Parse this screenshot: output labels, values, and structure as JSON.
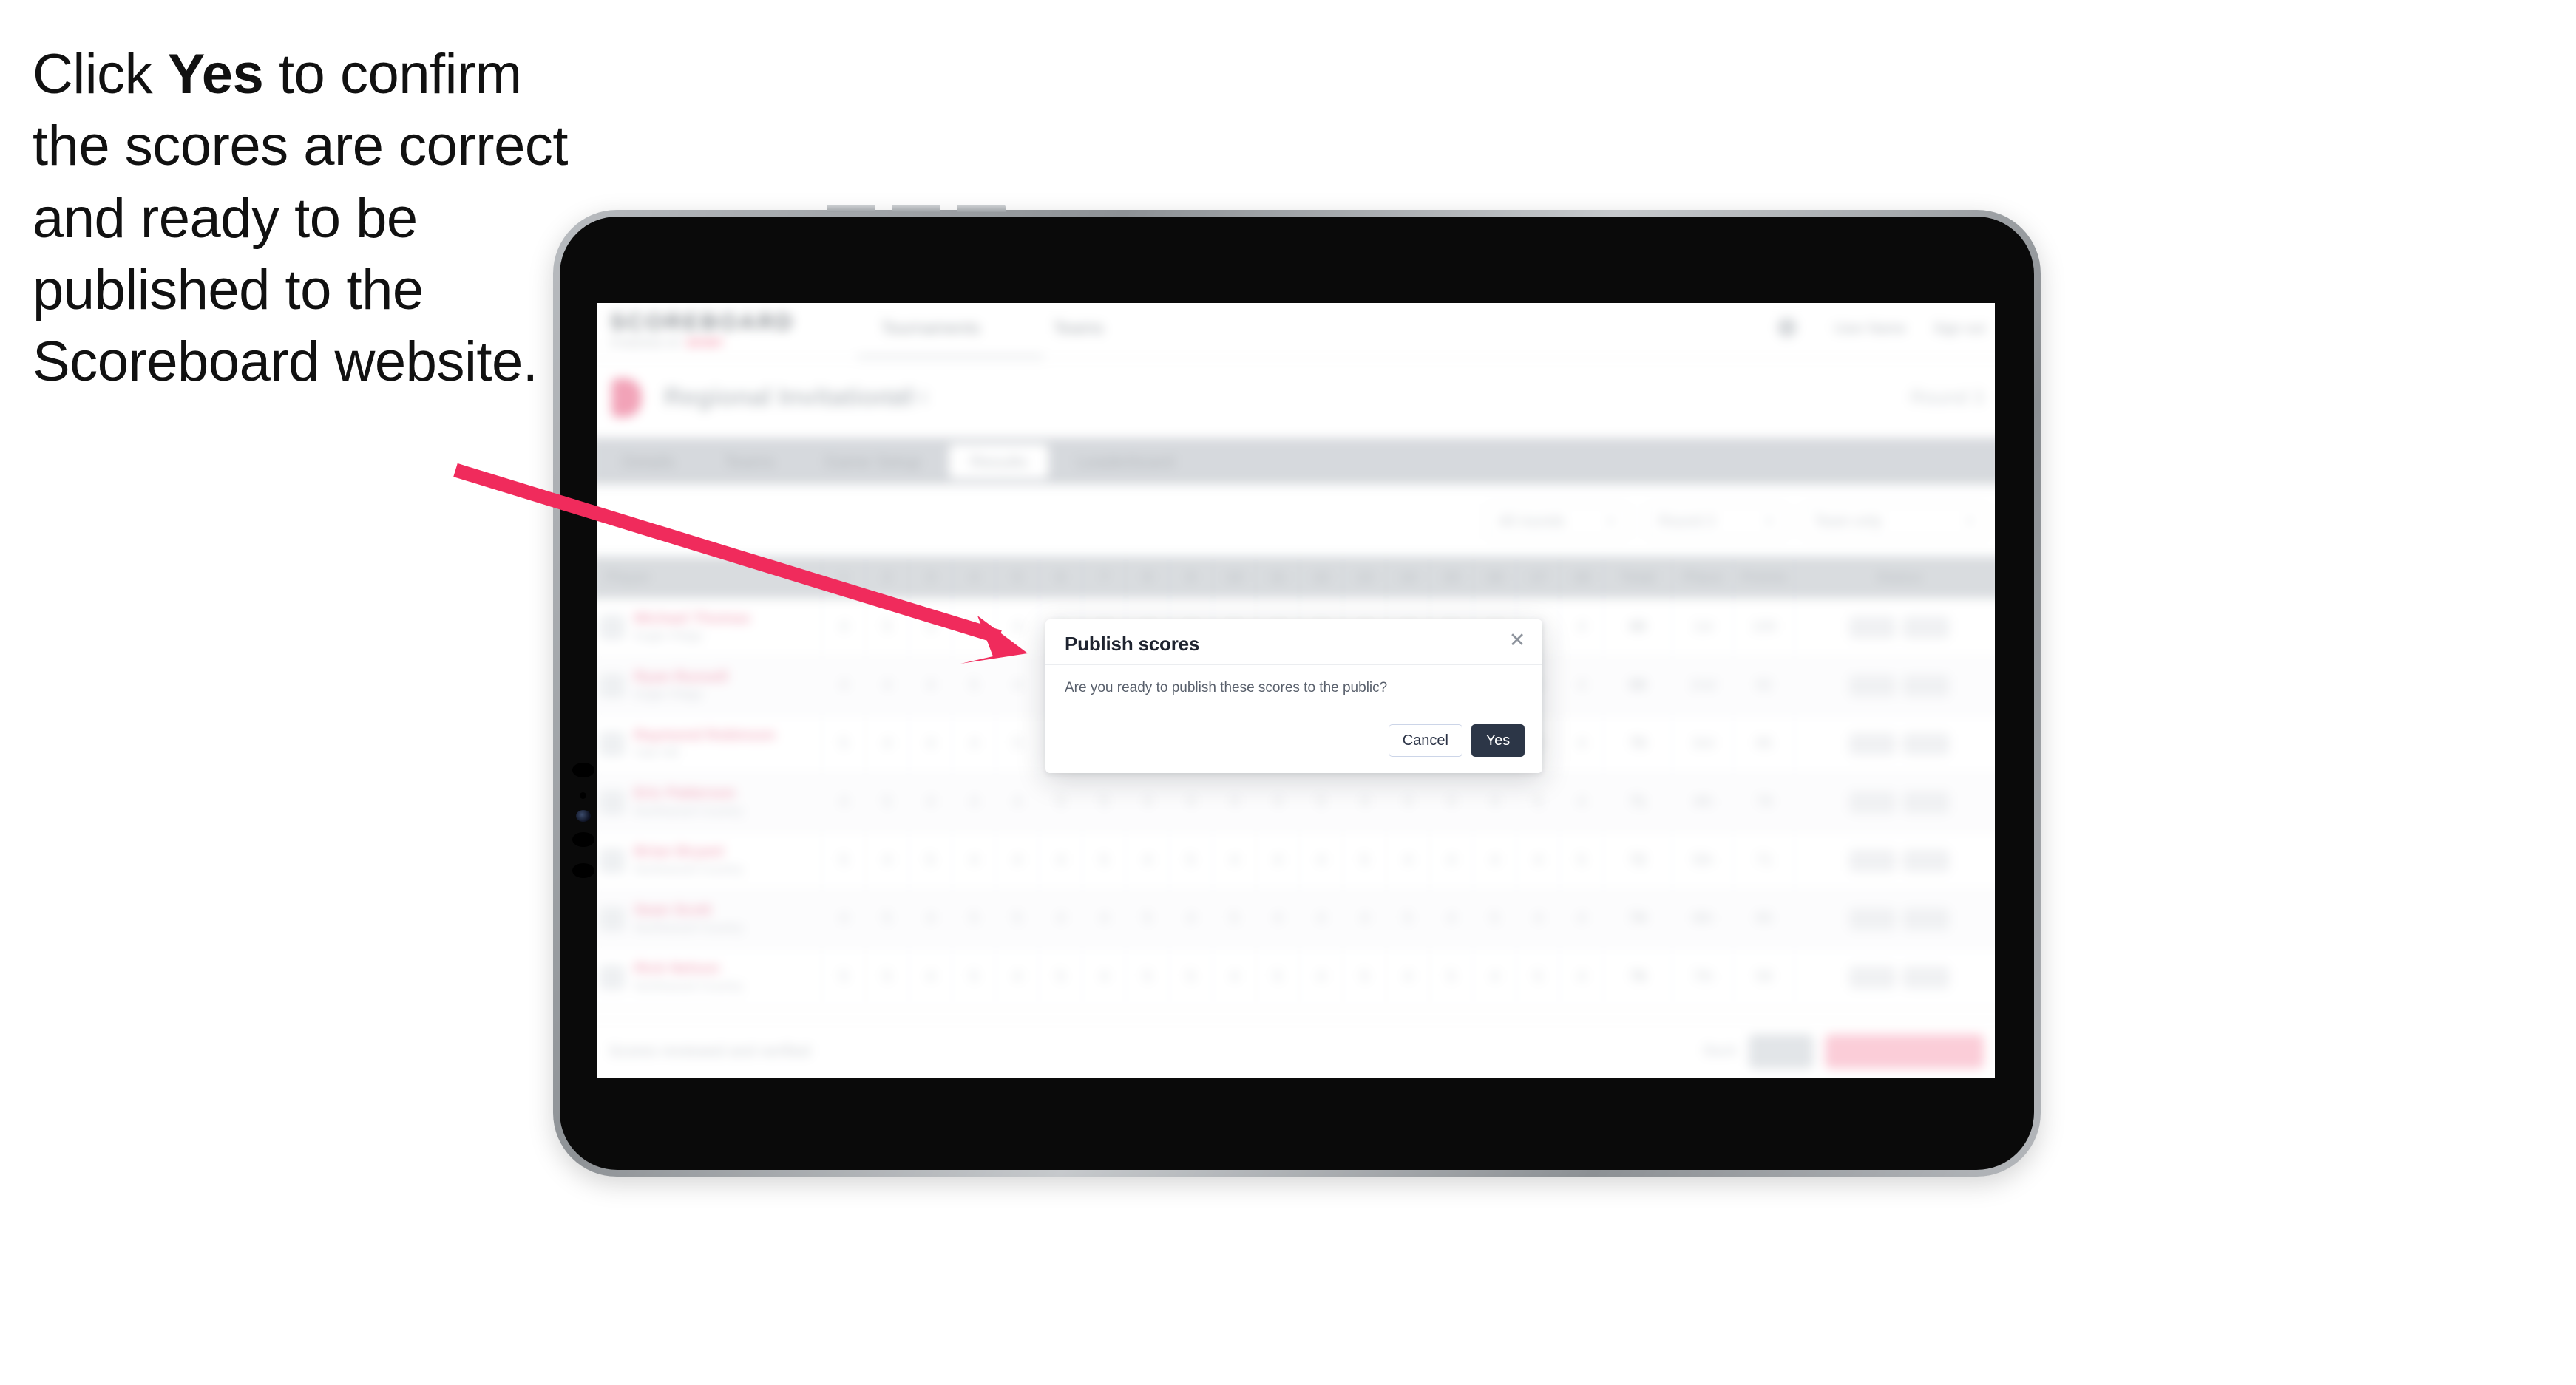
{
  "instruction": {
    "before": "Click ",
    "emphasis": "Yes",
    "after": " to confirm the scores are correct and ready to be published to the Scoreboard website."
  },
  "colors": {
    "arrow": "#F02B5C",
    "modal_primary_button": "#2C3647",
    "modal_cancel_border": "#CCD5E8",
    "brand_accent": "#F2718E"
  },
  "modal": {
    "title": "Publish scores",
    "message": "Are you ready to publish these scores to the public?",
    "close_icon": "close-icon",
    "cancel_label": "Cancel",
    "confirm_label": "Yes"
  },
  "app": {
    "header": {
      "logo": "SCOREBOARD",
      "logo_sub": "POWERED BY",
      "logo_sub_accent": "SPORT",
      "nav": [
        "Tournaments",
        "Teams"
      ],
      "account_icon": "user-avatar-icon",
      "account_name": "User Name",
      "sign_out": "Sign out"
    },
    "title_bar": {
      "icon": "trophy-icon",
      "title": "Regional Invitational",
      "subtitle": "2024",
      "right_meta": "Round 3"
    },
    "tabs": [
      {
        "label": "Details",
        "active": false
      },
      {
        "label": "Teams",
        "active": false
      },
      {
        "label": "Game Setup",
        "active": false
      },
      {
        "label": "Results",
        "active": true
      },
      {
        "label": "Leaderboard",
        "active": false
      }
    ],
    "toolbar": {
      "filters": [
        {
          "label": "All rounds",
          "caret": "chevron-down-icon"
        },
        {
          "label": "Round 3",
          "caret": "chevron-down-icon"
        },
        {
          "label": "Team only",
          "caret": "chevron-down-icon"
        }
      ]
    },
    "table": {
      "player_header": "Player",
      "score_headers": [
        "1",
        "2",
        "3",
        "4",
        "5",
        "6",
        "7",
        "8",
        "9",
        "10",
        "11",
        "12",
        "13",
        "14",
        "15",
        "16",
        "17",
        "18"
      ],
      "total_header": "Total",
      "end_headers": [
        "Place",
        "Points",
        "Status"
      ],
      "rows": [
        {
          "name": "Michael Thomas",
          "team": "Eagle Ridge",
          "scores": [
            "4",
            "5",
            "3",
            "4",
            "4",
            "5",
            "3",
            "4",
            "4",
            "5",
            "4",
            "3",
            "4",
            "4",
            "5",
            "3",
            "4",
            "4"
          ],
          "total": "68",
          "place": "1st",
          "points": "100",
          "status": "Final"
        },
        {
          "name": "Ryan Russell",
          "team": "Eagle Ridge",
          "scores": [
            "4",
            "4",
            "4",
            "5",
            "4",
            "4",
            "4",
            "4",
            "5",
            "4",
            "4",
            "4",
            "4",
            "5",
            "4",
            "4",
            "4",
            "4"
          ],
          "total": "69",
          "place": "2nd",
          "points": "92",
          "status": "Final"
        },
        {
          "name": "Raymond Robinson",
          "team": "Oak Hill",
          "scores": [
            "5",
            "4",
            "4",
            "4",
            "5",
            "4",
            "4",
            "5",
            "4",
            "4",
            "5",
            "4",
            "4",
            "4",
            "4",
            "5",
            "4",
            "4"
          ],
          "total": "70",
          "place": "3rd",
          "points": "85",
          "status": "Final"
        },
        {
          "name": "Eric Patterson",
          "team": "Northwood Country",
          "scores": [
            "4",
            "5",
            "4",
            "4",
            "4",
            "5",
            "5",
            "4",
            "4",
            "4",
            "4",
            "5",
            "4",
            "4",
            "4",
            "4",
            "5",
            "4"
          ],
          "total": "71",
          "place": "4th",
          "points": "78",
          "status": "Final"
        },
        {
          "name": "Brian Bryant",
          "team": "Northwood Country",
          "scores": [
            "5",
            "4",
            "5",
            "4",
            "4",
            "4",
            "5",
            "4",
            "5",
            "4",
            "4",
            "4",
            "5",
            "4",
            "4",
            "4",
            "4",
            "5"
          ],
          "total": "72",
          "place": "5th",
          "points": "71",
          "status": "Final"
        },
        {
          "name": "Sean Scott",
          "team": "Northwood Country",
          "scores": [
            "4",
            "5",
            "4",
            "5",
            "5",
            "4",
            "4",
            "5",
            "4",
            "5",
            "4",
            "4",
            "4",
            "5",
            "4",
            "5",
            "4",
            "4"
          ],
          "total": "74",
          "place": "6th",
          "points": "65",
          "status": "Final"
        },
        {
          "name": "Rick Nelson",
          "team": "Northwood Country",
          "scores": [
            "5",
            "5",
            "4",
            "5",
            "4",
            "5",
            "4",
            "5",
            "5",
            "4",
            "5",
            "4",
            "5",
            "4",
            "5",
            "4",
            "5",
            "4"
          ],
          "total": "76",
          "place": "7th",
          "points": "58",
          "status": "Final"
        }
      ]
    },
    "bottom_bar": {
      "note": "Scores reviewed and verified",
      "link": "Back",
      "secondary_button": "Save",
      "primary_button": "Publish to Scoreboard"
    }
  }
}
